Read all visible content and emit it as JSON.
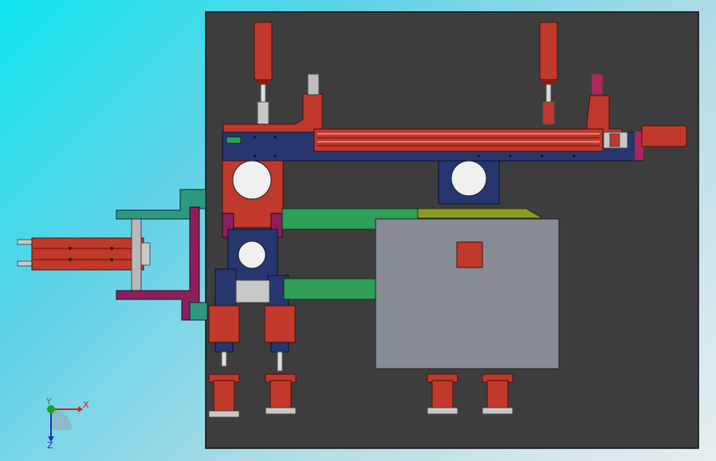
{
  "viewport": {
    "background_top_left": "#12e6ee",
    "background_bottom_right": "#e8eef0",
    "model_view": "front"
  },
  "colors": {
    "base_plate": "#3d3d3d",
    "actuator_red": "#c0392b",
    "mount_red_dark": "#9e2a1c",
    "rail_navy": "#27366e",
    "bracket_green": "#2f9e57",
    "bracket_teal": "#2c9a7f",
    "bracket_magenta": "#8b1f5c",
    "plate_gray": "#878b94",
    "bracket_olive": "#8a9a22",
    "silver": "#c8c8c8"
  },
  "axis_triad": {
    "x_label": "X",
    "y_label": "Y",
    "z_label": "Z",
    "x_color": "#d02020",
    "y_color": "#20a020",
    "z_color": "#2030c0"
  }
}
